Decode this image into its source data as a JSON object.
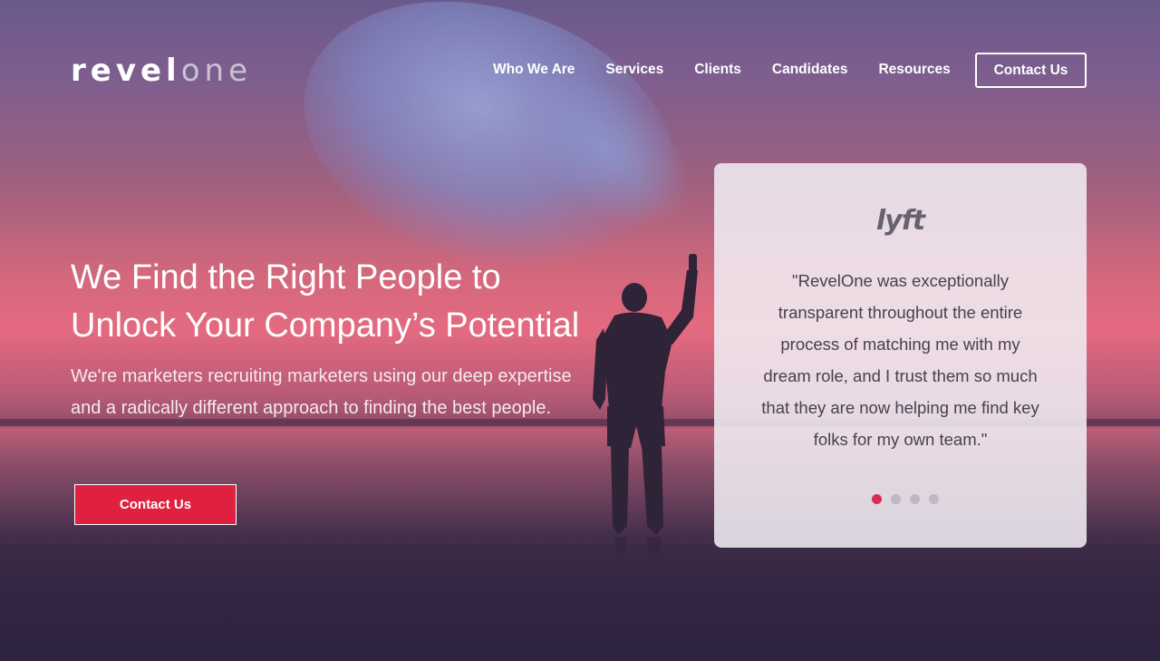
{
  "brand": {
    "logo_main": "revel",
    "logo_accent": "one"
  },
  "nav": {
    "items": [
      "Who We Are",
      "Services",
      "Clients",
      "Candidates",
      "Resources"
    ],
    "contact_label": "Contact Us"
  },
  "hero": {
    "title_line1": "We Find the Right People to",
    "title_line2": "Unlock Your Company’s Potential",
    "subtitle_line1": "We're marketers recruiting marketers using our deep expertise",
    "subtitle_line2": "and a radically different approach to finding the best people.",
    "cta_label": "Contact Us"
  },
  "testimonial": {
    "logo_text": "lyft",
    "quote_lines": [
      "\"RevelOne was exceptionally",
      "transparent throughout the entire",
      "process of matching me with my",
      "dream role, and I trust them so much",
      "that they are now helping me find key",
      "folks for my own team.\""
    ],
    "slides_total": 4,
    "active_slide": 1
  },
  "colors": {
    "accent": "#e0203f",
    "dot_active": "#d63050",
    "dot_inactive": "#bdb8c2"
  }
}
